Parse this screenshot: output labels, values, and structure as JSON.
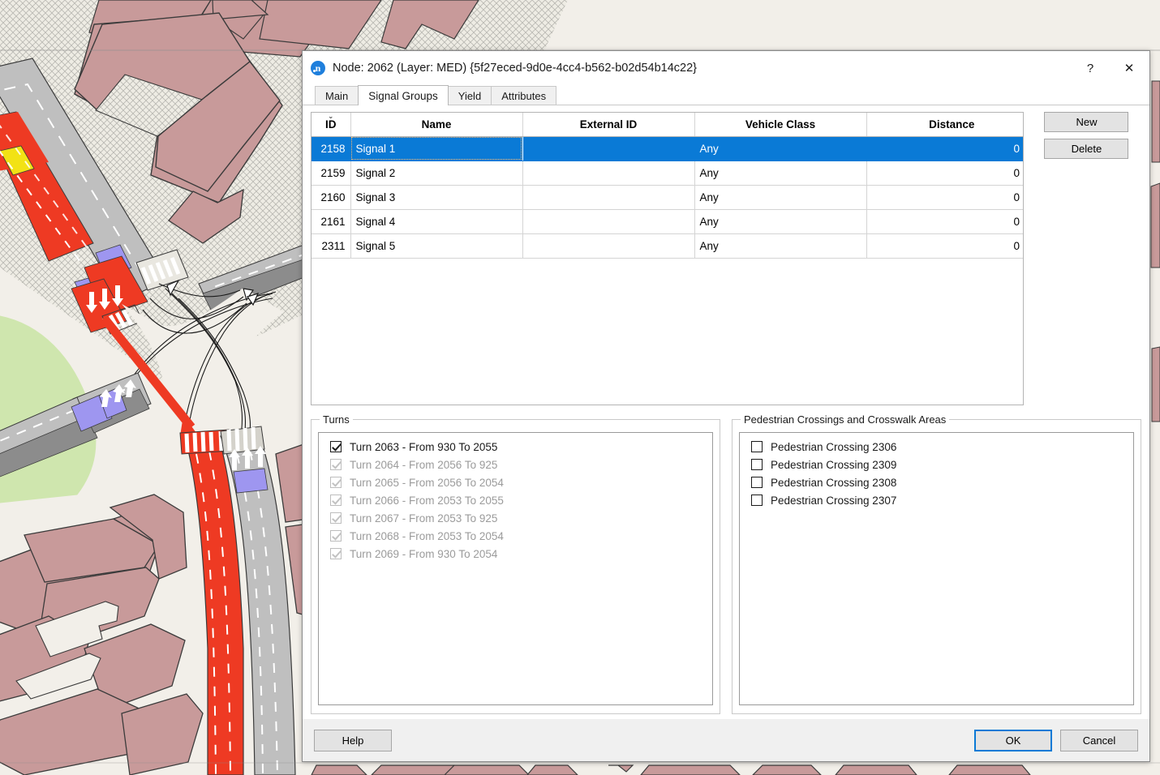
{
  "window": {
    "title": "Node: 2062 (Layer: MED) {5f27eced-9d0e-4cc4-b562-b02d54b14c22}",
    "icon": "n",
    "help_glyph": "?",
    "close_glyph": "✕"
  },
  "tabs": [
    {
      "label": "Main",
      "active": false
    },
    {
      "label": "Signal Groups",
      "active": true
    },
    {
      "label": "Yield",
      "active": false
    },
    {
      "label": "Attributes",
      "active": false
    }
  ],
  "table": {
    "sort_indicator": "⌄",
    "columns": [
      "ID",
      "Name",
      "External ID",
      "Vehicle Class",
      "Distance"
    ],
    "rows": [
      {
        "id": "2158",
        "name": "Signal 1",
        "external_id": "",
        "vehicle_class": "Any",
        "distance": "0 m",
        "selected": true
      },
      {
        "id": "2159",
        "name": "Signal 2",
        "external_id": "",
        "vehicle_class": "Any",
        "distance": "0 m",
        "selected": false
      },
      {
        "id": "2160",
        "name": "Signal 3",
        "external_id": "",
        "vehicle_class": "Any",
        "distance": "0 m",
        "selected": false
      },
      {
        "id": "2161",
        "name": "Signal 4",
        "external_id": "",
        "vehicle_class": "Any",
        "distance": "0 m",
        "selected": false
      },
      {
        "id": "2311",
        "name": "Signal 5",
        "external_id": "",
        "vehicle_class": "Any",
        "distance": "0 m",
        "selected": false
      }
    ]
  },
  "side_buttons": {
    "new": "New",
    "delete": "Delete"
  },
  "turns": {
    "legend": "Turns",
    "items": [
      {
        "label": "Turn 2063 - From 930 To 2055",
        "checked": true,
        "disabled": false
      },
      {
        "label": "Turn 2064 - From 2056 To 925",
        "checked": true,
        "disabled": true
      },
      {
        "label": "Turn 2065 - From 2056 To 2054",
        "checked": true,
        "disabled": true
      },
      {
        "label": "Turn 2066 - From 2053 To 2055",
        "checked": true,
        "disabled": true
      },
      {
        "label": "Turn 2067 - From 2053 To 925",
        "checked": true,
        "disabled": true
      },
      {
        "label": "Turn 2068 - From 2053 To 2054",
        "checked": true,
        "disabled": true
      },
      {
        "label": "Turn 2069 - From 930 To 2054",
        "checked": true,
        "disabled": true
      }
    ]
  },
  "pedestrian": {
    "legend": "Pedestrian Crossings and Crosswalk Areas",
    "items": [
      {
        "label": "Pedestrian Crossing 2306",
        "checked": false,
        "disabled": false
      },
      {
        "label": "Pedestrian Crossing 2309",
        "checked": false,
        "disabled": false
      },
      {
        "label": "Pedestrian Crossing 2308",
        "checked": false,
        "disabled": false
      },
      {
        "label": "Pedestrian Crossing 2307",
        "checked": false,
        "disabled": false
      }
    ]
  },
  "footer": {
    "help": "Help",
    "ok": "OK",
    "cancel": "Cancel"
  },
  "colors": {
    "selection_blue": "#0a7ad6",
    "map_building": "#c89a9a",
    "map_background": "#f2efe9",
    "map_road": "#bfbfbf",
    "highlight_red": "#ee3a23",
    "bus_lane_purple": "#9e96f0",
    "green_area": "#cfe6ae",
    "yellow_marking": "#f2e215"
  }
}
